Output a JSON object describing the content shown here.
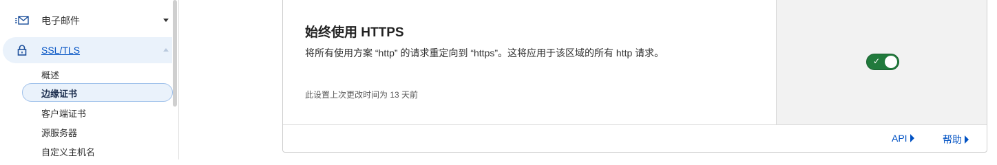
{
  "sidebar": {
    "email": {
      "label": "电子邮件",
      "icon": "email-icon"
    },
    "ssl": {
      "label": "SSL/TLS",
      "icon": "lock-icon"
    },
    "sub_items": [
      "概述",
      "边缘证书",
      "客户端证书",
      "源服务器",
      "自定义主机名"
    ],
    "active_sub_index": 1
  },
  "card": {
    "title": "始终使用 HTTPS",
    "description": "将所有使用方案 “http” 的请求重定向到 “https”。这将应用于该区域的所有 http 请求。",
    "last_changed": "此设置上次更改时间为 13 天前",
    "toggle": {
      "on": true,
      "check": "✓"
    },
    "footer": {
      "api_label": "API",
      "help_label": "帮助"
    }
  },
  "colors": {
    "accent": "#0051c3",
    "toggle_on": "#217a3c",
    "active_bg": "#eaf2fb"
  }
}
